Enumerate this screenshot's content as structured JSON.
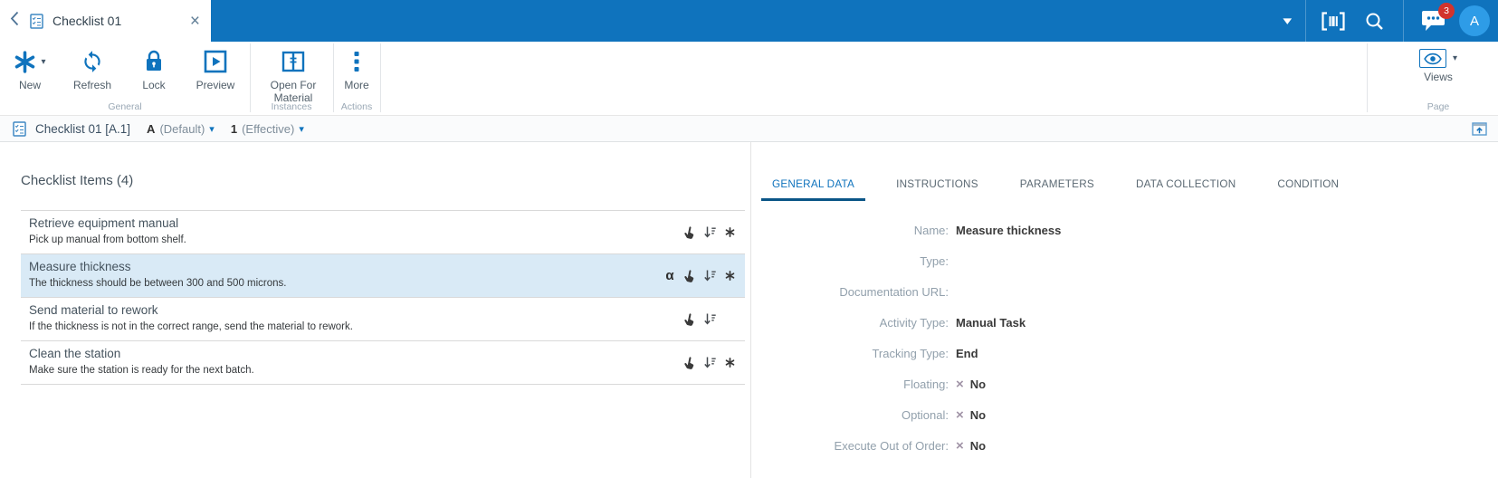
{
  "topbar": {
    "tab_title": "Checklist 01",
    "notification_count": "3",
    "avatar_initial": "A"
  },
  "toolbar": {
    "buttons": [
      {
        "label": "New"
      },
      {
        "label": "Refresh"
      },
      {
        "label": "Lock"
      },
      {
        "label": "Preview"
      },
      {
        "label": "Open For Material"
      },
      {
        "label": "More"
      }
    ],
    "views_label": "Views",
    "groups": [
      {
        "label": "General"
      },
      {
        "label": "Instances"
      },
      {
        "label": "Actions"
      },
      {
        "label": "Page"
      }
    ]
  },
  "breadcrumb": {
    "title": "Checklist 01 [A.1]",
    "revision_value": "A",
    "revision_qualifier": "(Default)",
    "version_value": "1",
    "version_qualifier": "(Effective)"
  },
  "checklist": {
    "heading": "Checklist Items (4)",
    "items": [
      {
        "title": "Retrieve equipment manual",
        "description": "Pick up manual from bottom shelf."
      },
      {
        "title": "Measure thickness",
        "description": "The thickness should be between 300 and 500 microns."
      },
      {
        "title": "Send material to rework",
        "description": "If the thickness is not in the correct range, send the material to rework."
      },
      {
        "title": "Clean the station",
        "description": "Make sure the station is ready for the next batch."
      }
    ]
  },
  "details": {
    "tabs": [
      {
        "label": "GENERAL DATA"
      },
      {
        "label": "INSTRUCTIONS"
      },
      {
        "label": "PARAMETERS"
      },
      {
        "label": "DATA COLLECTION"
      },
      {
        "label": "CONDITION"
      }
    ],
    "fields": [
      {
        "label": "Name:",
        "value": "Measure thickness"
      },
      {
        "label": "Type:",
        "value": ""
      },
      {
        "label": "Documentation URL:",
        "value": ""
      },
      {
        "label": "Activity Type:",
        "value": "Manual Task"
      },
      {
        "label": "Tracking Type:",
        "value": "End"
      },
      {
        "label": "Floating:",
        "value": "No"
      },
      {
        "label": "Optional:",
        "value": "No"
      },
      {
        "label": "Execute Out of Order:",
        "value": "No"
      }
    ]
  },
  "icons": {
    "alpha": "α",
    "caret": "▾",
    "close": "×",
    "no_mark": "×"
  },
  "colors": {
    "topbar_blue": "#0f73bd",
    "accent_blue": "#0f73bd",
    "selected_row": "#d9eaf6",
    "badge_red": "#d2332c",
    "avatar_blue": "#2e9ce7",
    "active_tab_underline": "#0a5587"
  }
}
